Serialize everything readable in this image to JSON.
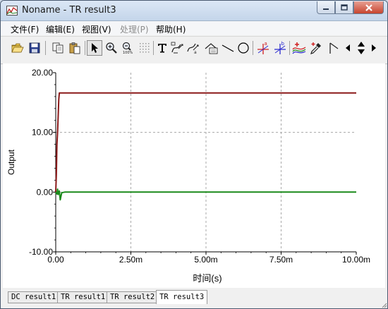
{
  "window": {
    "title": "Noname - TR result3"
  },
  "menu": [
    {
      "label": "文件(F)",
      "disabled": false
    },
    {
      "label": "编辑(E)",
      "disabled": false
    },
    {
      "label": "视图(V)",
      "disabled": false
    },
    {
      "label": "处理(P)",
      "disabled": true
    },
    {
      "label": "帮助(H)",
      "disabled": false
    }
  ],
  "toolbar": {
    "buttons": [
      {
        "icon": "open-folder-icon"
      },
      {
        "icon": "save-icon"
      },
      {
        "icon": "copy-icon"
      },
      {
        "icon": "paste-icon"
      },
      {
        "icon": "pointer-icon",
        "active": true
      },
      {
        "icon": "zoom-in-icon"
      },
      {
        "icon": "zoom-100-icon"
      },
      {
        "icon": "grid-icon"
      },
      {
        "icon": "text-tool-icon"
      },
      {
        "icon": "annotate-curve-icon"
      },
      {
        "icon": "annotate-curve-2-icon"
      },
      {
        "icon": "annotate-box-icon"
      },
      {
        "icon": "line-tool-icon"
      },
      {
        "icon": "ellipse-tool-icon"
      },
      {
        "icon": "cursor-a-icon"
      },
      {
        "icon": "cursor-b-icon"
      },
      {
        "icon": "add-curve-icon"
      },
      {
        "icon": "color-picker-icon"
      },
      {
        "icon": "flag-icon"
      },
      {
        "icon": "scroll-left-icon"
      },
      {
        "icon": "scroll-updown-icon"
      },
      {
        "icon": "scroll-right-icon"
      }
    ]
  },
  "chart_data": {
    "type": "line",
    "title": "",
    "xlabel": "时间(s)",
    "ylabel": "Output",
    "xlim": [
      0,
      0.01
    ],
    "ylim": [
      -10,
      20
    ],
    "x_ticks": [
      "0.00",
      "2.50m",
      "5.00m",
      "7.50m",
      "10.00m"
    ],
    "y_ticks": [
      "20.00",
      "10.00",
      "0.00",
      "-10.00"
    ],
    "grid": true,
    "series": [
      {
        "color": "#8b1a1a",
        "x": [
          0,
          2e-05,
          4e-05,
          6e-05,
          8e-05,
          0.0001,
          0.00012,
          0.01
        ],
        "y": [
          0,
          3,
          8,
          10,
          12.5,
          15.5,
          16.6,
          16.6
        ]
      },
      {
        "color": "#1a8a1a",
        "x": [
          0,
          4e-05,
          6e-05,
          8e-05,
          0.00012,
          0.00015,
          0.0002,
          0.0003,
          0.01
        ],
        "y": [
          0,
          -0.3,
          0.5,
          -0.4,
          0.2,
          -1.3,
          -0.1,
          0,
          0
        ]
      }
    ]
  },
  "tabs": [
    {
      "label": "DC result1",
      "active": false
    },
    {
      "label": "TR result1",
      "active": false
    },
    {
      "label": "TR result2",
      "active": false
    },
    {
      "label": "TR result3",
      "active": true
    }
  ]
}
